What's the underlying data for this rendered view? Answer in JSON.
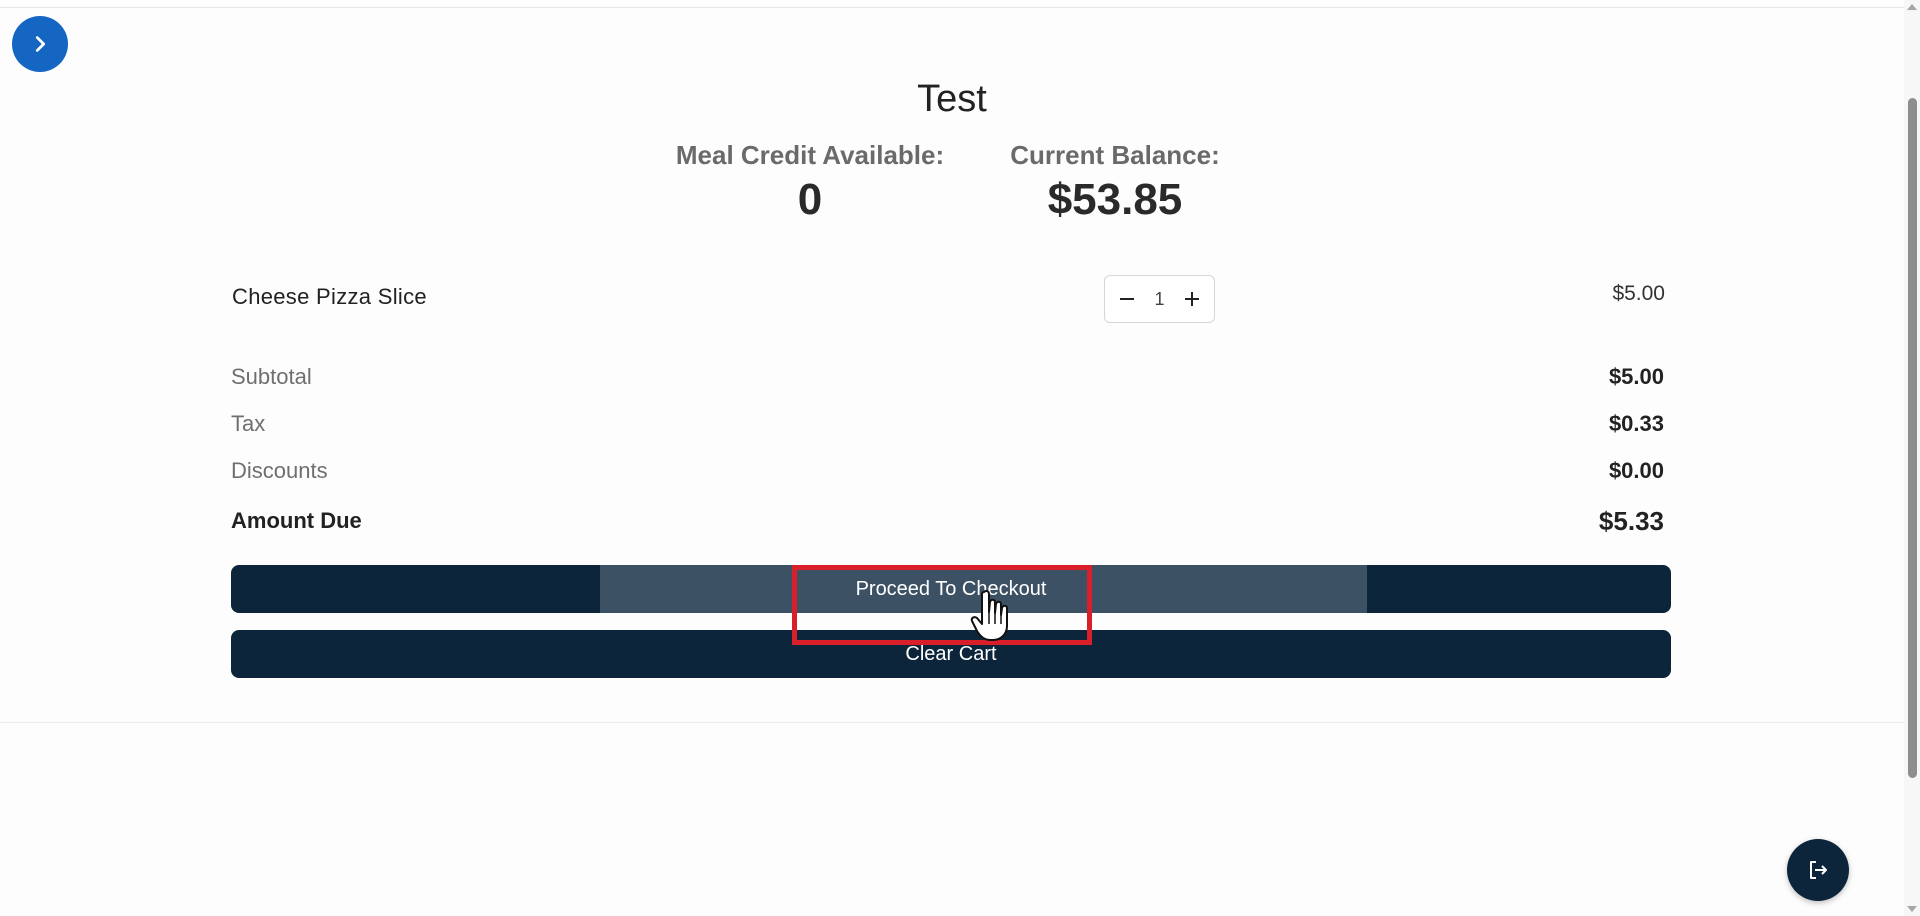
{
  "header": {
    "title": "Test"
  },
  "stats": {
    "meal_credit_label": "Meal Credit Available:",
    "meal_credit_value": "0",
    "balance_label": "Current Balance:",
    "balance_value": "$53.85"
  },
  "cart": {
    "items": [
      {
        "name": "Cheese Pizza Slice",
        "quantity": "1",
        "price": "$5.00"
      }
    ]
  },
  "summary": {
    "subtotal_label": "Subtotal",
    "subtotal_value": "$5.00",
    "tax_label": "Tax",
    "tax_value": "$0.33",
    "discounts_label": "Discounts",
    "discounts_value": "$0.00",
    "amount_due_label": "Amount Due",
    "amount_due_value": "$5.33"
  },
  "actions": {
    "checkout_label": "Proceed To Checkout",
    "clear_label": "Clear Cart"
  },
  "icons": {
    "sidebar_toggle": "chevron-right-icon",
    "logout": "logout-icon",
    "decrement": "minus-icon",
    "increment": "plus-icon"
  },
  "colors": {
    "primary_dark": "#0d253a",
    "toggle_blue": "#1466c2",
    "highlight_red": "#d9202a",
    "button_hover": "#3d5165"
  }
}
